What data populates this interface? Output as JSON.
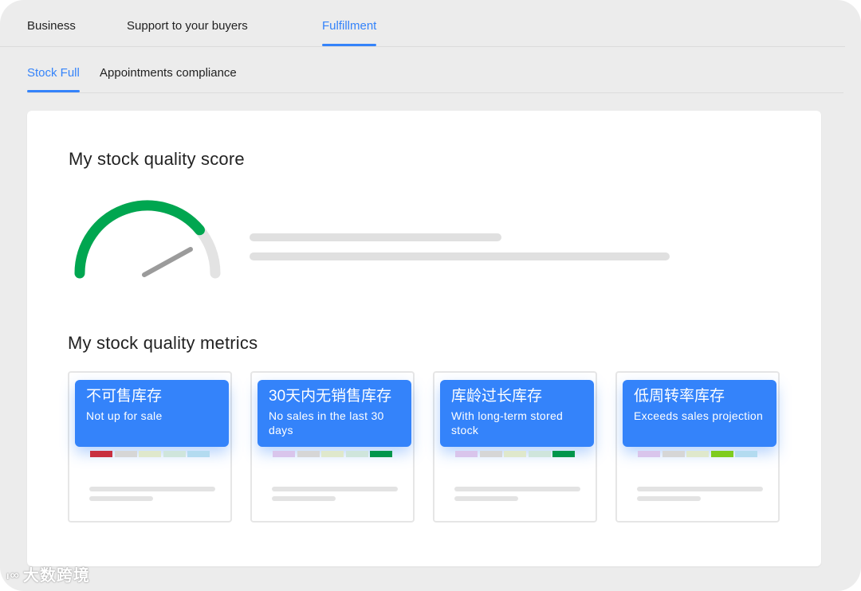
{
  "top_tabs": [
    {
      "label": "Business"
    },
    {
      "label": "Support to your buyers"
    },
    {
      "label": "Fulfillment"
    }
  ],
  "top_tabs_active": "Fulfillment",
  "sub_tabs": [
    {
      "label": "Stock Full"
    },
    {
      "label": "Appointments compliance"
    }
  ],
  "sub_tabs_active": "Stock Full",
  "score": {
    "title": "My stock quality score",
    "gauge_level": 0.78,
    "gauge_color": "#00a650"
  },
  "metrics": {
    "title": "My stock quality metrics",
    "cards": [
      {
        "title": "不可售库存",
        "subtitle": "Not up for sale",
        "highlight_index": 0,
        "highlight_color": "#c8303f"
      },
      {
        "title": "30天内无销售库存",
        "subtitle": "No sales in the last 30 days",
        "highlight_index": 4,
        "highlight_color": "#00964c"
      },
      {
        "title": "库龄过长库存",
        "subtitle": "With long-term stored stock",
        "highlight_index": 4,
        "highlight_color": "#00964c"
      },
      {
        "title": "低周转率库存",
        "subtitle": "Exceeds sales projection",
        "highlight_index": 3,
        "highlight_color": "#7fcc1f"
      }
    ],
    "swatch_colors": [
      "#d9c5ec",
      "#d6d6d6",
      "#dfe8cc",
      "#cfe5dc",
      "#b3dbf0"
    ]
  },
  "colors": {
    "accent": "#3483fa",
    "background": "#ececec"
  },
  "watermark": {
    "logo": "ₗ∞",
    "text": "大数跨境"
  }
}
